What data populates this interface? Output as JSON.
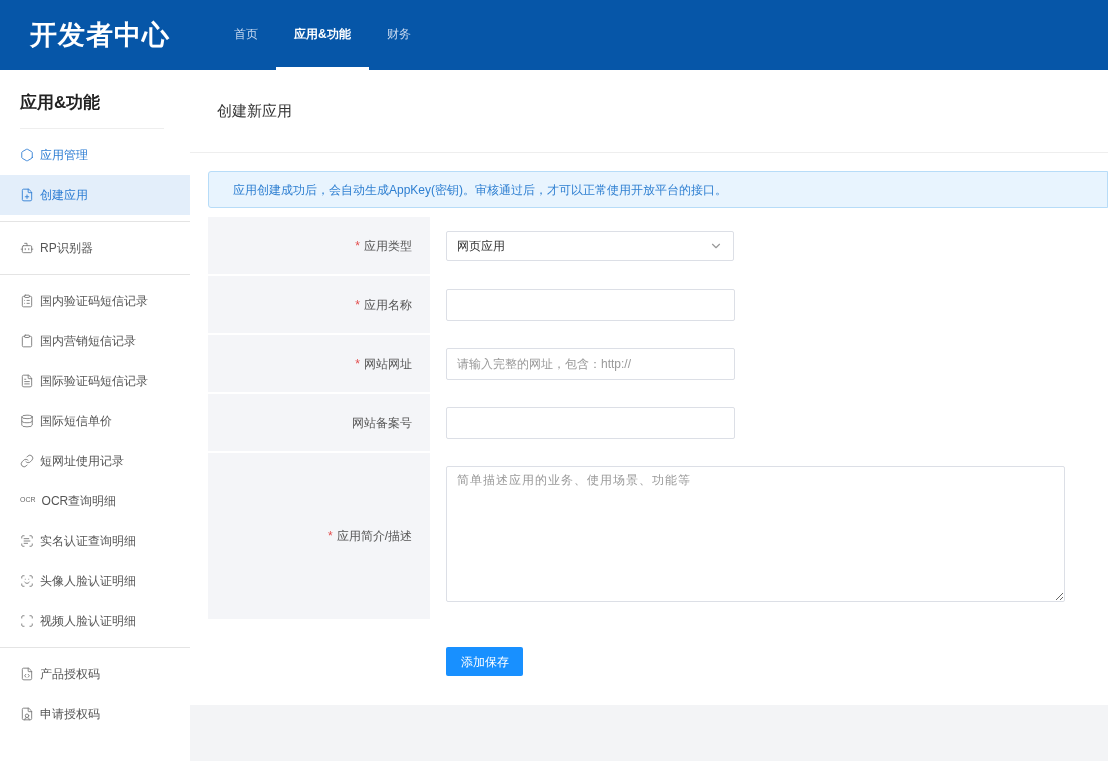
{
  "header": {
    "logo": "开发者中心",
    "nav": [
      {
        "label": "首页",
        "selected": false
      },
      {
        "label": "应用&功能",
        "selected": true
      },
      {
        "label": "财务",
        "selected": false
      }
    ]
  },
  "sidebar": {
    "title": "应用&功能",
    "groups": [
      {
        "accent": true,
        "items": [
          {
            "label": "应用管理",
            "selected": false
          },
          {
            "label": "创建应用",
            "selected": true
          }
        ]
      },
      {
        "accent": false,
        "items": [
          {
            "label": "RP识别器",
            "selected": false
          }
        ]
      },
      {
        "accent": false,
        "items": [
          {
            "label": "国内验证码短信记录",
            "selected": false
          },
          {
            "label": "国内营销短信记录",
            "selected": false
          },
          {
            "label": "国际验证码短信记录",
            "selected": false
          },
          {
            "label": "国际短信单价",
            "selected": false
          },
          {
            "label": "短网址使用记录",
            "selected": false
          },
          {
            "label": "OCR查询明细",
            "selected": false,
            "badge": "OCR"
          },
          {
            "label": "实名认证查询明细",
            "selected": false
          },
          {
            "label": "头像人脸认证明细",
            "selected": false
          },
          {
            "label": "视频人脸认证明细",
            "selected": false
          }
        ]
      },
      {
        "accent": false,
        "items": [
          {
            "label": "产品授权码",
            "selected": false
          },
          {
            "label": "申请授权码",
            "selected": false
          }
        ]
      }
    ]
  },
  "page": {
    "title": "创建新应用",
    "notice": "应用创建成功后，会自动生成AppKey(密钥)。审核通过后，才可以正常使用开放平台的接口。",
    "fields": [
      {
        "kind": "select",
        "label": "应用类型",
        "marker": "*",
        "value": "网页应用"
      },
      {
        "kind": "input",
        "label": "应用名称",
        "marker": "*"
      },
      {
        "kind": "input",
        "label": "网站网址",
        "marker": "*",
        "placeholder": "请输入完整的网址，包含：http://"
      },
      {
        "kind": "input",
        "label": "网站备案号"
      },
      {
        "kind": "textarea",
        "label": "应用简介/描述",
        "marker": "*",
        "placeholder": "简单描述应用的业务、使用场景、功能等"
      }
    ],
    "submit": "添加保存"
  }
}
